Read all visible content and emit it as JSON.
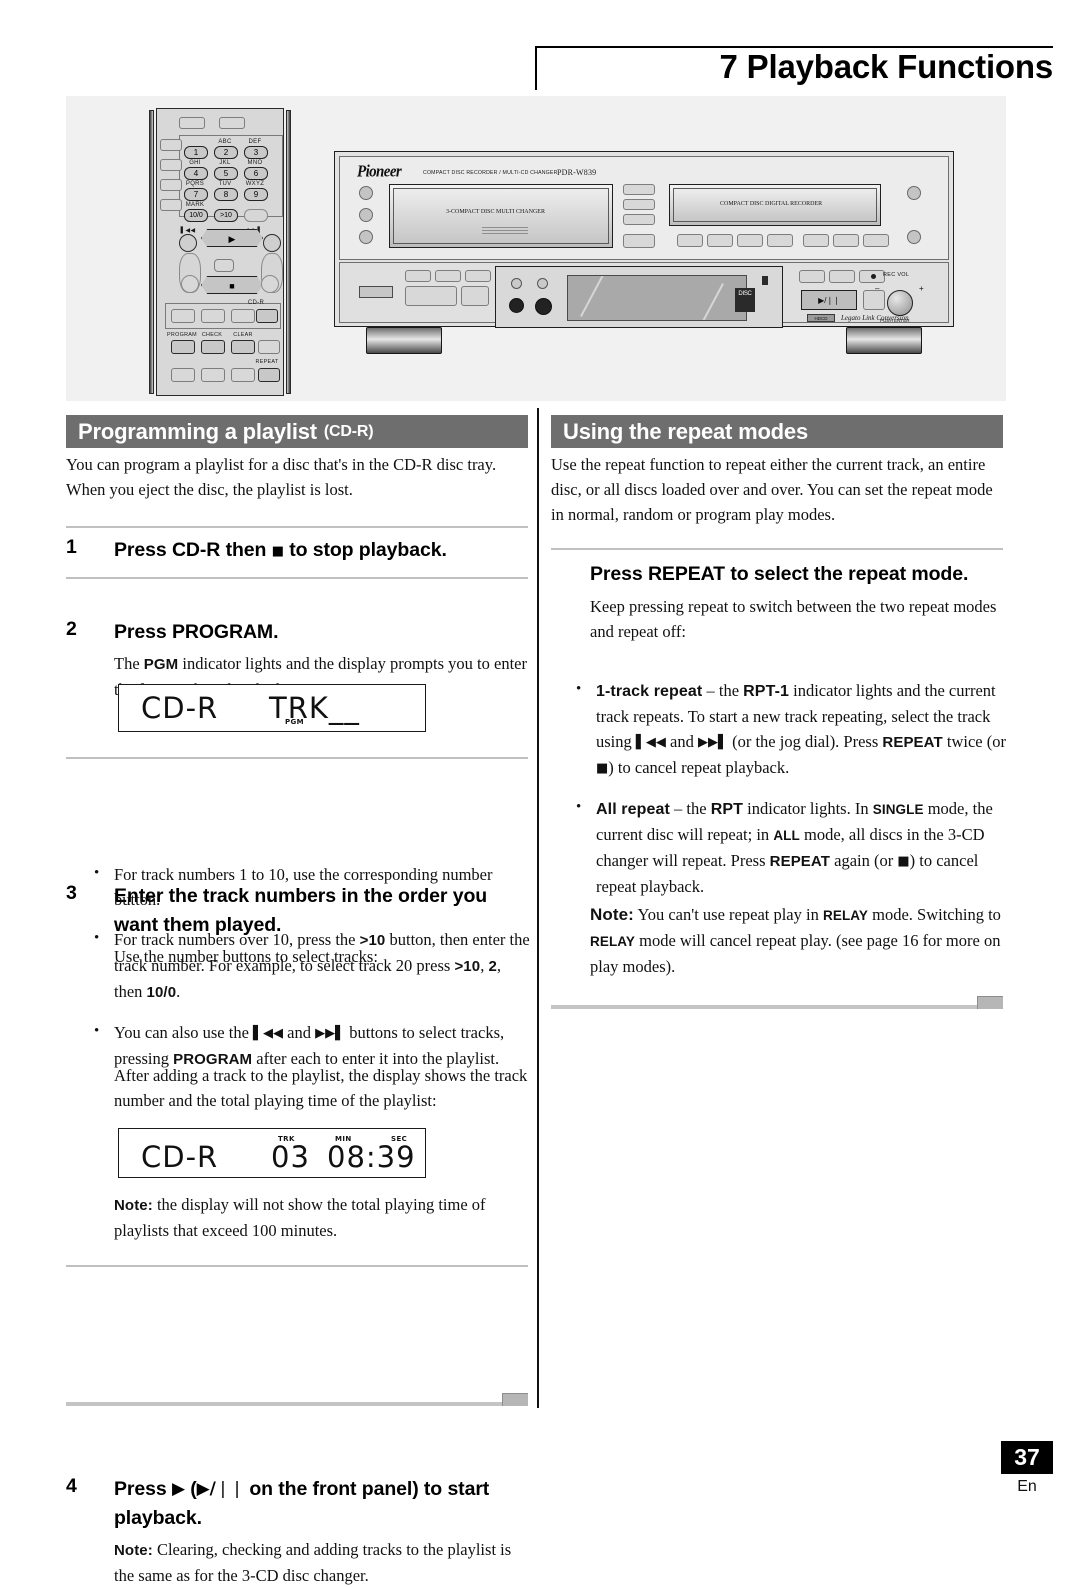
{
  "header": {
    "title": "7 Playback Functions"
  },
  "illustration": {
    "remote": {
      "numpad": [
        {
          "key": "1",
          "letters": ""
        },
        {
          "key": "2",
          "letters": "ABC"
        },
        {
          "key": "3",
          "letters": "DEF"
        },
        {
          "key": "4",
          "letters": "GHI"
        },
        {
          "key": "5",
          "letters": "JKL"
        },
        {
          "key": "6",
          "letters": "MNO"
        },
        {
          "key": "7",
          "letters": "PQRS"
        },
        {
          "key": "8",
          "letters": "TUV"
        },
        {
          "key": "9",
          "letters": "WXYZ"
        },
        {
          "key": "10/0",
          "letters": "MARK"
        },
        {
          "key": ">10",
          "letters": ""
        }
      ],
      "transport": {
        "prev_label": "▌◀◀",
        "next_label": "▶▶▌",
        "play": "▶",
        "stop": "■"
      },
      "function_labels": {
        "cdr": "CD-R",
        "program": "PROGRAM",
        "check": "CHECK",
        "clear": "CLEAR",
        "repeat": "REPEAT"
      }
    },
    "stereo": {
      "brand": "Pioneer",
      "category": "COMPACT DISC RECORDER / MULTI-CD CHANGER",
      "model": "PDR-W839",
      "changer_tray_label": "3-COMPACT DISC MULTI CHANGER",
      "recorder_tray_label": "COMPACT DISC DIGITAL RECORDER",
      "rec_vol_label": "REC VOL",
      "push_enter_label": "PUSH ENTER",
      "play_pause_label": "▶/❘❘",
      "hdcd_badge": "HDCD",
      "legato_text": "Legato Link Conversion",
      "disc_logo": "DISC"
    }
  },
  "left_column": {
    "section_title_main": "Programming a playlist",
    "section_title_sub": "(CD-R)",
    "intro": "You can program a playlist for a disc that's in the CD-R disc tray. When you eject the disc, the playlist is lost.",
    "steps": [
      {
        "num": "1",
        "head_a": "Press CD-R then ",
        "head_glyph": "■",
        "head_b": " to stop playback."
      },
      {
        "num": "2",
        "head": "Press PROGRAM.",
        "body_a": "The ",
        "body_bold": "PGM",
        "body_b": " indicator lights and the display prompts you to enter the first track in the playlist:"
      },
      {
        "num": "3",
        "head": "Enter the track numbers in the order you want them played.",
        "body": "Use the number buttons to select tracks:"
      },
      {
        "num": "4",
        "head_a": "Press ",
        "head_glyph1": "▶",
        "head_b": " (",
        "head_glyph2": "▶/❘❘",
        "head_c": " on the front panel) to start playback.",
        "note_label": "Note:",
        "note_body": " Clearing, checking and adding tracks to the playlist is the same as for the 3-CD disc changer."
      }
    ],
    "display_1": {
      "left": "CD-R",
      "right": "TRK__",
      "mini_label": "PGM"
    },
    "display_2": {
      "left": "CD-R",
      "track": "03",
      "time": "08:39",
      "mini_trk": "TRK",
      "mini_min": "MIN",
      "mini_sec": "SEC"
    },
    "bullets": [
      {
        "p1": "For track numbers 1 to 10, use the corresponding number button."
      },
      {
        "p1": "For track numbers over 10, press the ",
        "b1": ">10",
        "p2": " button, then enter the track number. For example, to select track 20 press ",
        "b2": ">10",
        "p3": ", ",
        "b3": "2",
        "p4": ", then ",
        "b4": "10/0",
        "p5": "."
      },
      {
        "p1": "You can also use the ",
        "g1": "▌◀◀",
        "p2": " and ",
        "g2": "▶▶▌",
        "p3": " buttons to select tracks, pressing ",
        "b1": "PROGRAM",
        "p4": " after each to enter it into the playlist."
      }
    ],
    "after_add_text": "After adding a track to the playlist, the display shows the track number and the total playing time of the playlist:",
    "note_display": {
      "label": "Note:",
      "body": " the display will not show the total playing time of playlists that exceed 100 minutes."
    }
  },
  "right_column": {
    "section_title_main": "Using the repeat modes",
    "intro": "Use the repeat function to repeat either the current track, an entire disc, or all discs loaded over and over. You can set the repeat mode in normal, random or program play modes.",
    "sub_head": "Press REPEAT to select the repeat mode.",
    "sub_body": "Keep pressing repeat to switch between the two repeat modes and repeat off:",
    "bullets": [
      {
        "b1": "1-track repeat",
        "p1": " – the ",
        "b2": "RPT-1",
        "p2": " indicator lights and the current track repeats. To start a new track repeating, select the track using ",
        "g1": "▌◀◀",
        "p3": " and ",
        "g2": "▶▶▌",
        "p4": " (or the jog dial). Press ",
        "b3": "REPEAT",
        "p5": " twice (or ",
        "g3": "■",
        "p6": ") to cancel repeat playback."
      },
      {
        "b1": "All repeat",
        "p1": " – the ",
        "b2": "RPT",
        "p2": " indicator lights. In ",
        "b3": "SINGLE",
        "p3": " mode, the current disc will repeat; in ",
        "b4": "ALL",
        "p4": " mode, all discs in the 3-CD changer will repeat. Press ",
        "b5": "REPEAT",
        "p5": " again (or ",
        "g1": "■",
        "p6": ") to cancel repeat playback."
      }
    ],
    "note": {
      "label": "Note:",
      "p1": " You can't use repeat play in ",
      "b1": "RELAY",
      "p2": " mode. Switching to ",
      "b2": "RELAY",
      "p3": " mode will cancel repeat play. (see page 16 for more on play modes)."
    }
  },
  "footer": {
    "page_number": "37",
    "language_code": "En"
  }
}
